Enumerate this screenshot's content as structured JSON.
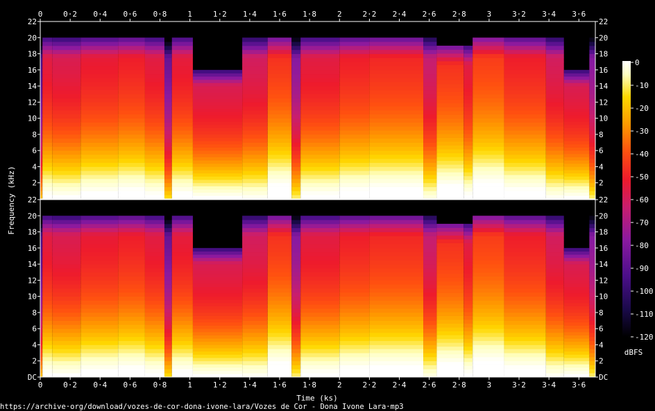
{
  "chart_data": {
    "type": "heatmap",
    "subtype": "spectrogram",
    "channels": 2,
    "xlabel": "Time (ks)",
    "ylabel": "Frequency (kHz)",
    "colorbar_label": "dBFS",
    "x_ticks": [
      "0",
      "0·2",
      "0·4",
      "0·6",
      "0·8",
      "1",
      "1·2",
      "1·4",
      "1·6",
      "1·8",
      "2",
      "2·2",
      "2·4",
      "2·6",
      "2·8",
      "3",
      "3·2",
      "3·4",
      "3·6"
    ],
    "x_tick_values": [
      0,
      0.2,
      0.4,
      0.6,
      0.8,
      1.0,
      1.2,
      1.4,
      1.6,
      1.8,
      2.0,
      2.2,
      2.4,
      2.6,
      2.8,
      3.0,
      3.2,
      3.4,
      3.6
    ],
    "xlim": [
      0,
      3.71
    ],
    "y_ticks_top": [
      "22",
      "20",
      "18",
      "16",
      "14",
      "12",
      "10",
      "8",
      "6",
      "4",
      "2"
    ],
    "y_ticks_bottom": [
      "22",
      "20",
      "18",
      "16",
      "14",
      "12",
      "10",
      "8",
      "6",
      "4",
      "2",
      "DC"
    ],
    "ylim_khz": [
      0,
      22
    ],
    "colorbar_ticks": [
      "0",
      "-10",
      "-20",
      "-30",
      "-40",
      "-50",
      "-60",
      "-70",
      "-80",
      "-90",
      "-100",
      "-110",
      "-120"
    ],
    "colorbar_range_dbfs": [
      -120,
      0
    ],
    "colors": {
      "background": "#000000",
      "colormap": [
        "#000000",
        "#1a0a4a",
        "#4b0f8a",
        "#8a1aa0",
        "#c81e6e",
        "#ee1b2c",
        "#ff5010",
        "#ff9a00",
        "#ffd800",
        "#ffffc0",
        "#ffffff"
      ]
    },
    "segments": [
      {
        "start": 0.0,
        "end": 0.015,
        "cutoff_khz": 20,
        "level": 0.35
      },
      {
        "start": 0.015,
        "end": 0.08,
        "cutoff_khz": 20,
        "level": 0.62
      },
      {
        "start": 0.08,
        "end": 0.27,
        "cutoff_khz": 20,
        "level": 0.6
      },
      {
        "start": 0.27,
        "end": 0.52,
        "cutoff_khz": 20,
        "level": 0.64
      },
      {
        "start": 0.52,
        "end": 0.7,
        "cutoff_khz": 20,
        "level": 0.66
      },
      {
        "start": 0.7,
        "end": 0.83,
        "cutoff_khz": 20,
        "level": 0.62
      },
      {
        "start": 0.83,
        "end": 0.88,
        "cutoff_khz": 20,
        "level": 0.4
      },
      {
        "start": 0.88,
        "end": 1.02,
        "cutoff_khz": 20,
        "level": 0.63
      },
      {
        "start": 1.02,
        "end": 1.35,
        "cutoff_khz": 16,
        "level": 0.6
      },
      {
        "start": 1.35,
        "end": 1.52,
        "cutoff_khz": 20,
        "level": 0.58
      },
      {
        "start": 1.52,
        "end": 1.68,
        "cutoff_khz": 20,
        "level": 0.7
      },
      {
        "start": 1.68,
        "end": 1.74,
        "cutoff_khz": 20,
        "level": 0.45
      },
      {
        "start": 1.74,
        "end": 2.0,
        "cutoff_khz": 20,
        "level": 0.62
      },
      {
        "start": 2.0,
        "end": 2.2,
        "cutoff_khz": 20,
        "level": 0.66
      },
      {
        "start": 2.2,
        "end": 2.56,
        "cutoff_khz": 20,
        "level": 0.68
      },
      {
        "start": 2.56,
        "end": 2.65,
        "cutoff_khz": 20,
        "level": 0.55
      },
      {
        "start": 2.65,
        "end": 2.83,
        "cutoff_khz": 19,
        "level": 0.7
      },
      {
        "start": 2.83,
        "end": 2.89,
        "cutoff_khz": 19,
        "level": 0.62
      },
      {
        "start": 2.89,
        "end": 3.1,
        "cutoff_khz": 20,
        "level": 0.72
      },
      {
        "start": 3.1,
        "end": 3.38,
        "cutoff_khz": 20,
        "level": 0.66
      },
      {
        "start": 3.38,
        "end": 3.5,
        "cutoff_khz": 20,
        "level": 0.58
      },
      {
        "start": 3.5,
        "end": 3.67,
        "cutoff_khz": 16,
        "level": 0.6
      },
      {
        "start": 3.67,
        "end": 3.71,
        "cutoff_khz": 20,
        "level": 0.45
      }
    ]
  },
  "footer": {
    "source_url": "https://archive·org/download/vozes-de-cor-dona-ivone-lara/Vozes de Cor - Dona Ivone Lara·mp3"
  }
}
